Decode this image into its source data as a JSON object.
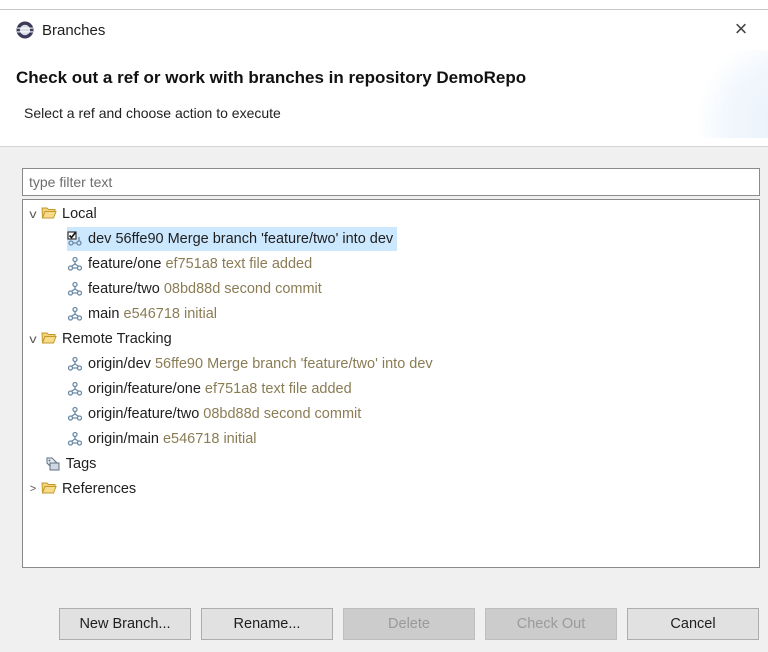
{
  "window": {
    "title": "Branches",
    "close_glyph": "×",
    "icon": "eclipse-app-icon"
  },
  "banner": {
    "title": "Check out a ref or work with branches in repository DemoRepo",
    "subtitle": "Select a ref and choose action to execute"
  },
  "filter": {
    "placeholder": "type filter text",
    "value": ""
  },
  "tree": {
    "local": {
      "label": "Local",
      "expanded": true,
      "items": [
        {
          "name": "dev",
          "desc": "56ffe90 Merge branch 'feature/two' into dev",
          "checked_out": true,
          "selected": true
        },
        {
          "name": "feature/one",
          "desc": "ef751a8 text file added"
        },
        {
          "name": "feature/two",
          "desc": "08bd88d second commit"
        },
        {
          "name": "main",
          "desc": "e546718 initial"
        }
      ]
    },
    "remote": {
      "label": "Remote Tracking",
      "expanded": true,
      "items": [
        {
          "name": "origin/dev",
          "desc": "56ffe90 Merge branch 'feature/two' into dev"
        },
        {
          "name": "origin/feature/one",
          "desc": "ef751a8 text file added"
        },
        {
          "name": "origin/feature/two",
          "desc": "08bd88d second commit"
        },
        {
          "name": "origin/main",
          "desc": "e546718 initial"
        }
      ]
    },
    "tags": {
      "label": "Tags"
    },
    "references": {
      "label": "References",
      "expanded": false
    }
  },
  "buttons": {
    "new_branch": "New Branch...",
    "rename": "Rename...",
    "delete": "Delete",
    "check_out": "Check Out",
    "cancel": "Cancel"
  },
  "colors": {
    "selection": "#cce8ff",
    "commit_text": "#8a7c55",
    "branch_icon": "#6a8aa6"
  }
}
